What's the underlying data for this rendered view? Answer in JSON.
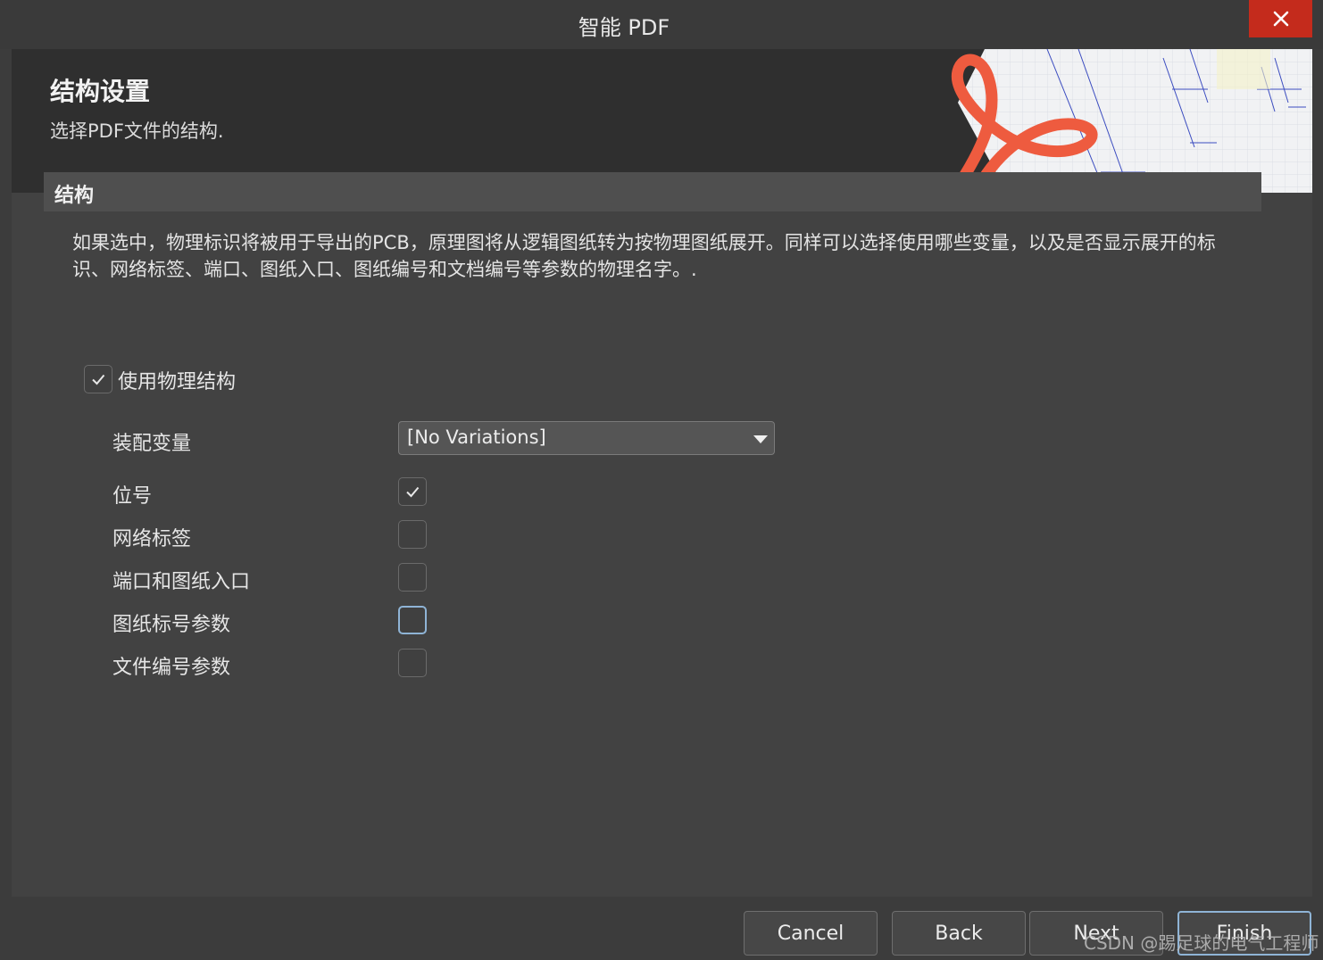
{
  "window": {
    "title": "智能 PDF",
    "close_glyph": "✕"
  },
  "header": {
    "title": "结构设置",
    "subtitle": "选择PDF文件的结构."
  },
  "section": {
    "title": "结构",
    "description": "如果选中，物理标识将被用于导出的PCB，原理图将从逻辑图纸转为按物理图纸展开。同样可以选择使用哪些变量，以及是否显示展开的标识、网络标签、端口、图纸入口、图纸编号和文档编号等参数的物理名字。."
  },
  "options": {
    "use_physical": {
      "label": "使用物理结构",
      "checked": true
    },
    "variation_label": "装配变量",
    "variation_value": "[No Variations]",
    "designator": {
      "label": "位号",
      "checked": true
    },
    "net_labels": {
      "label": "网络标签",
      "checked": false
    },
    "ports": {
      "label": "端口和图纸入口",
      "checked": false
    },
    "sheet_number": {
      "label": "图纸标号参数",
      "checked": false
    },
    "document_number": {
      "label": "文件编号参数",
      "checked": false
    }
  },
  "buttons": {
    "cancel": "Cancel",
    "back": "Back",
    "next": "Next",
    "finish": "Finish"
  },
  "watermark": "CSDN @踢足球的电气工程师",
  "colors": {
    "close_red": "#c42b1c",
    "focus_blue": "#8fb4d6",
    "logo_red": "#ee5b3f"
  }
}
